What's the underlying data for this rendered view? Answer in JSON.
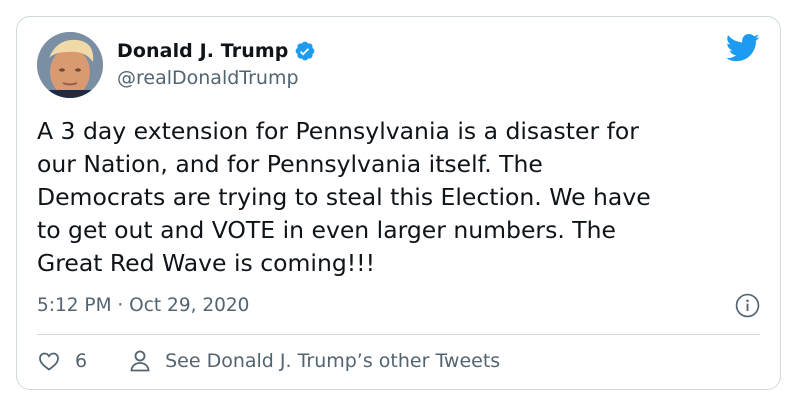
{
  "tweet": {
    "author": {
      "name": "Donald J. Trump",
      "handle": "@realDonaldTrump",
      "verified": true
    },
    "text": "A 3 day extension for Pennsylvania is a disaster for\nour Nation, and for Pennsylvania itself. The\nDemocrats are trying to steal this Election. We have\nto get out and VOTE in even larger numbers. The\nGreat Red Wave is coming!!!",
    "timestamp": "5:12 PM · Oct 29, 2020",
    "likes": "6",
    "see_more_label": "See Donald J. Trump’s other Tweets"
  },
  "colors": {
    "brand_blue": "#1d9bf0",
    "secondary_text": "#536471",
    "border": "#cfd9de"
  },
  "icons": {
    "logo": "twitter-bird-icon",
    "verified": "verified-badge-icon",
    "info": "info-icon",
    "like": "heart-icon",
    "profile": "person-icon"
  }
}
